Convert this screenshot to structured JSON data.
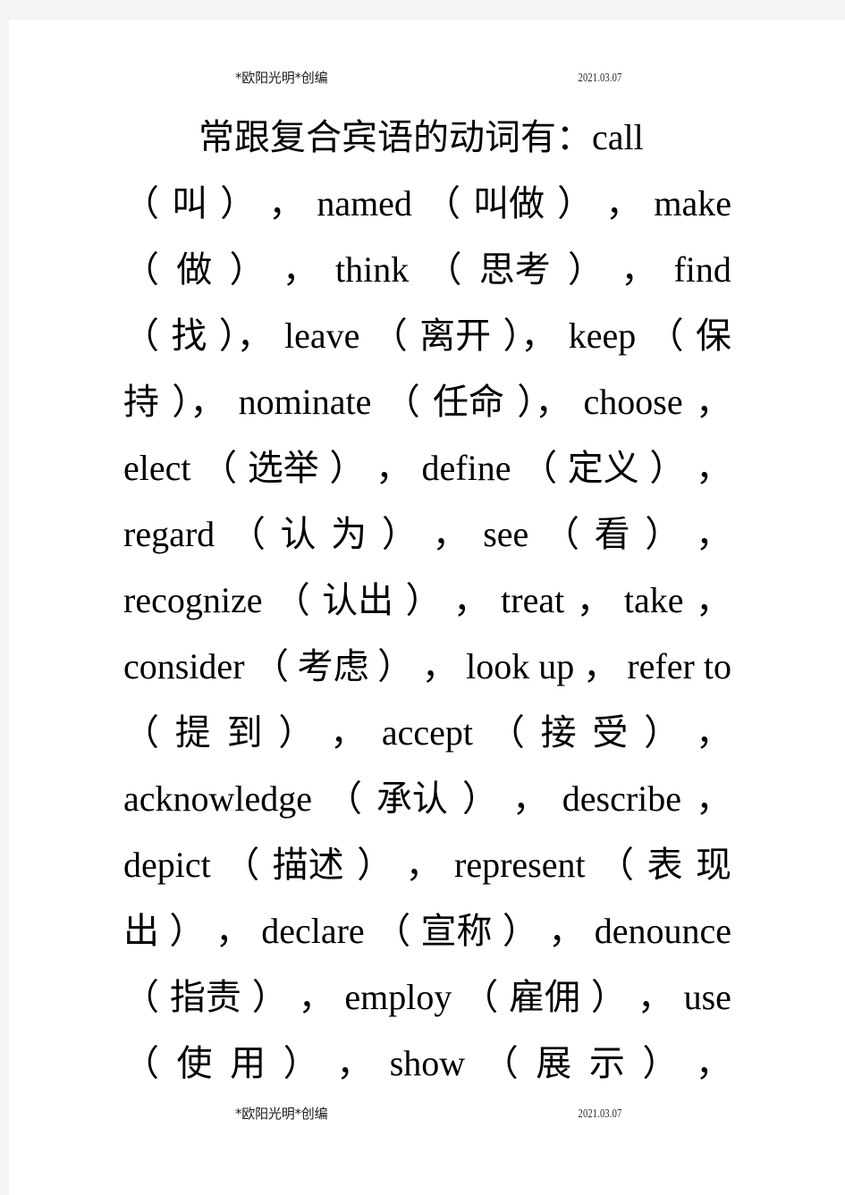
{
  "document": {
    "background_color": "#f4f4f4",
    "paper_color": "#ffffff",
    "text_color": "#000000"
  },
  "running_head": {
    "left": "*欧阳光明*创编",
    "right": "2021.03.07"
  },
  "running_foot": {
    "left": "*欧阳光明*创编",
    "right": "2021.03.07"
  },
  "body": {
    "full_text": "常跟复合宾语的动词有：call（叫），named（叫做），make（做），think（思考），find（找），leave（离开），keep（保持），nominate（任命），choose，elect（选举），define（定义），regard（认为），see（看），recognize（认出），treat，take，consider（考虑），look up，refer to（提到），accept（接受），acknowledge（承认），describe，depict（描述），represent（表现出），declare（宣称），denounce（指责），employ（雇佣），use（使用），show（展示），",
    "lines": [
      "常跟复合宾语的动词有：call",
      "（叫），named（叫做），make",
      "（做），think（思考），find",
      "（找），leave（离开），keep（保",
      "持），nominate（任命），choose，",
      "elect（选举），define（定义），",
      "regard（认为），see（看），",
      "recognize（认出），treat，take，",
      "consider（考虑），look up，refer to",
      "（提到），accept（接受），",
      "acknowledge（承认），describe，",
      "depict（描述），represent（表现",
      "出），declare（宣称），denounce",
      "（指责），employ（雇佣），use",
      "（使用），show（展示），"
    ]
  }
}
